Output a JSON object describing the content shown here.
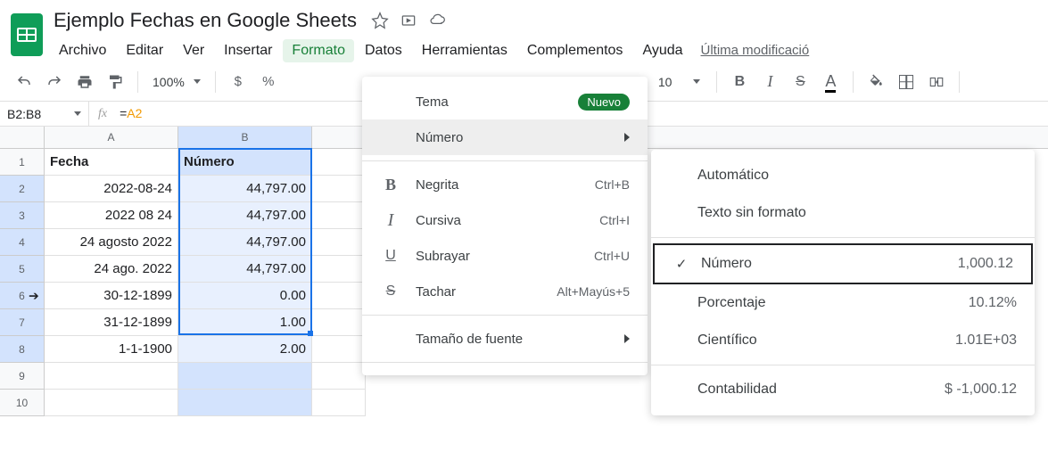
{
  "doc_title": "Ejemplo Fechas en Google Sheets",
  "menubar": {
    "archivo": "Archivo",
    "editar": "Editar",
    "ver": "Ver",
    "insertar": "Insertar",
    "formato": "Formato",
    "datos": "Datos",
    "herramientas": "Herramientas",
    "complementos": "Complementos",
    "ayuda": "Ayuda",
    "last_mod": "Última modificació"
  },
  "toolbar": {
    "zoom": "100%",
    "currency": "$",
    "percent": "%",
    "font_size": "10"
  },
  "namebox": "B2:B8",
  "formula": {
    "eq": "=",
    "ref": "A2"
  },
  "columns": {
    "A": "A",
    "B": "B"
  },
  "rows": {
    "1": {
      "n": "1",
      "A": "Fecha",
      "B": "Número"
    },
    "2": {
      "n": "2",
      "A": "2022-08-24",
      "B": "44,797.00"
    },
    "3": {
      "n": "3",
      "A": "2022 08 24",
      "B": "44,797.00"
    },
    "4": {
      "n": "4",
      "A": "24 agosto 2022",
      "B": "44,797.00"
    },
    "5": {
      "n": "5",
      "A": "24 ago. 2022",
      "B": "44,797.00"
    },
    "6": {
      "n": "6",
      "A": "30-12-1899",
      "B": "0.00"
    },
    "7": {
      "n": "7",
      "A": "31-12-1899",
      "B": "1.00"
    },
    "8": {
      "n": "8",
      "A": "1-1-1900",
      "B": "2.00"
    },
    "9": {
      "n": "9"
    },
    "10": {
      "n": "10"
    }
  },
  "format_menu": {
    "tema": "Tema",
    "nuevo": "Nuevo",
    "numero": "Número",
    "negrita": "Negrita",
    "negrita_sc": "Ctrl+B",
    "cursiva": "Cursiva",
    "cursiva_sc": "Ctrl+I",
    "subrayar": "Subrayar",
    "subrayar_sc": "Ctrl+U",
    "tachar": "Tachar",
    "tachar_sc": "Alt+Mayús+5",
    "tamano": "Tamaño de fuente"
  },
  "number_menu": {
    "automatico": "Automático",
    "texto": "Texto sin formato",
    "numero": "Número",
    "numero_ex": "1,000.12",
    "porcentaje": "Porcentaje",
    "porcentaje_ex": "10.12%",
    "cientifico": "Científico",
    "cientifico_ex": "1.01E+03",
    "contabilidad": "Contabilidad",
    "contabilidad_ex": "$ -1,000.12"
  }
}
